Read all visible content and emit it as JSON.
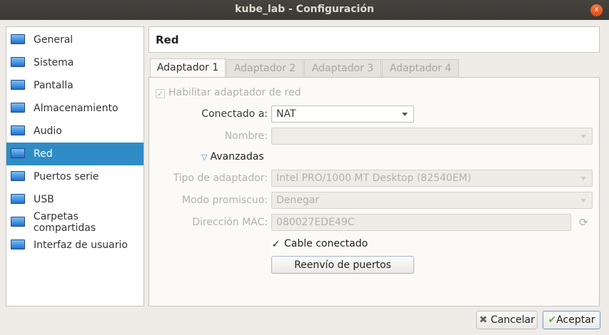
{
  "window": {
    "title": "kube_lab - Configuración"
  },
  "sidebar": {
    "items": [
      {
        "label": "General",
        "icon": "monitor-icon"
      },
      {
        "label": "Sistema",
        "icon": "chip-icon"
      },
      {
        "label": "Pantalla",
        "icon": "display-icon"
      },
      {
        "label": "Almacenamiento",
        "icon": "disk-icon"
      },
      {
        "label": "Audio",
        "icon": "speaker-icon"
      },
      {
        "label": "Red",
        "icon": "network-icon",
        "selected": true
      },
      {
        "label": "Puertos serie",
        "icon": "serial-port-icon"
      },
      {
        "label": "USB",
        "icon": "usb-icon"
      },
      {
        "label": "Carpetas compartidas",
        "icon": "folder-icon"
      },
      {
        "label": "Interfaz de usuario",
        "icon": "window-icon"
      }
    ]
  },
  "header": {
    "title": "Red"
  },
  "tabs": [
    {
      "label": "Adaptador 1",
      "active": true
    },
    {
      "label": "Adaptador 2"
    },
    {
      "label": "Adaptador 3"
    },
    {
      "label": "Adaptador 4"
    }
  ],
  "form": {
    "enable_label": "Habilitar adaptador de red",
    "connected_label": "Conectado a:",
    "connected_value": "NAT",
    "name_label": "Nombre:",
    "name_value": "",
    "advanced_label": "Avanzadas",
    "type_label": "Tipo de adaptador:",
    "type_value": "Intel PRO/1000 MT Desktop (82540EM)",
    "promisc_label": "Modo promiscuo:",
    "promisc_value": "Denegar",
    "mac_label": "Dirección MAC:",
    "mac_value": "080027EDE49C",
    "cable_label": "Cable conectado",
    "port_forward_label": "Reenvío de puertos"
  },
  "footer": {
    "cancel": "Cancelar",
    "ok": "Aceptar"
  },
  "colors": {
    "selection": "#308cc6",
    "titlebar": "#3c3b37"
  }
}
